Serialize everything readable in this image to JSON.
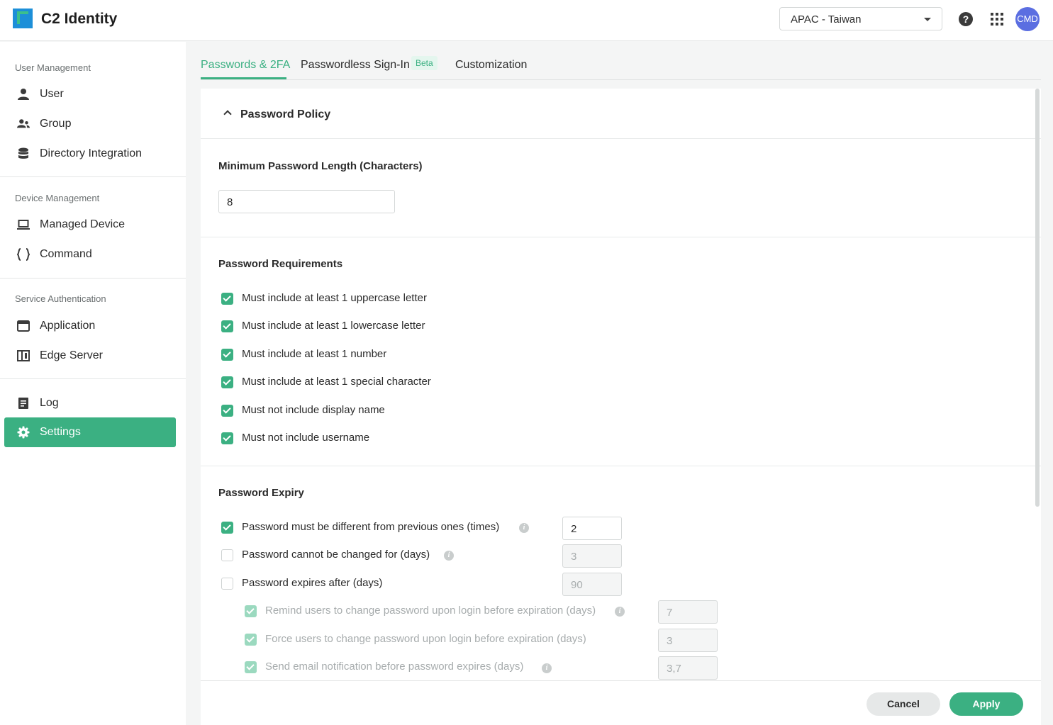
{
  "header": {
    "app_title": "C2 Identity",
    "region": "APAC - Taiwan",
    "help_symbol": "?",
    "avatar_text": "CMD"
  },
  "sidebar": {
    "sections": [
      {
        "title": "User Management",
        "items": [
          {
            "label": "User",
            "icon": "user-icon"
          },
          {
            "label": "Group",
            "icon": "group-icon"
          },
          {
            "label": "Directory Integration",
            "icon": "database-icon"
          }
        ]
      },
      {
        "title": "Device Management",
        "items": [
          {
            "label": "Managed Device",
            "icon": "laptop-icon"
          },
          {
            "label": "Command",
            "icon": "braces-icon"
          }
        ]
      },
      {
        "title": "Service Authentication",
        "items": [
          {
            "label": "Application",
            "icon": "app-window-icon"
          },
          {
            "label": "Edge Server",
            "icon": "server-icon"
          }
        ]
      },
      {
        "title": "",
        "items": [
          {
            "label": "Log",
            "icon": "log-icon"
          },
          {
            "label": "Settings",
            "icon": "gear-icon",
            "active": true
          }
        ]
      }
    ]
  },
  "tabs": {
    "passwords": "Passwords & 2FA",
    "passwordless": "Passwordless Sign-In",
    "beta": "Beta",
    "customization": "Customization"
  },
  "policy": {
    "title": "Password Policy",
    "min_length": {
      "label": "Minimum Password Length (Characters)",
      "value": "8"
    },
    "requirements": {
      "title": "Password Requirements",
      "items": [
        {
          "label": "Must include at least 1 uppercase letter",
          "checked": true
        },
        {
          "label": "Must include at least 1 lowercase letter",
          "checked": true
        },
        {
          "label": "Must include at least 1 number",
          "checked": true
        },
        {
          "label": "Must include at least 1 special character",
          "checked": true
        },
        {
          "label": "Must not include display name",
          "checked": true
        },
        {
          "label": "Must not include username",
          "checked": true
        }
      ]
    },
    "expiry": {
      "title": "Password Expiry",
      "different_previous": {
        "label": "Password must be different from previous ones (times)",
        "value": "2",
        "checked": true
      },
      "cannot_change": {
        "label": "Password cannot be changed for (days)",
        "value": "3",
        "checked": false
      },
      "expires_after": {
        "label": "Password expires after (days)",
        "value": "90",
        "checked": false
      },
      "remind": {
        "label": "Remind users to change password upon login before expiration (days)",
        "value": "7",
        "checked": true
      },
      "force": {
        "label": "Force users to change password upon login before expiration (days)",
        "value": "3",
        "checked": true
      },
      "email": {
        "label": "Send email notification before password expires (days)",
        "value": "3,7",
        "checked": true
      }
    }
  },
  "footer": {
    "cancel": "Cancel",
    "apply": "Apply"
  },
  "colors": {
    "accent": "#3bb082",
    "avatar": "#5b6ee1"
  }
}
